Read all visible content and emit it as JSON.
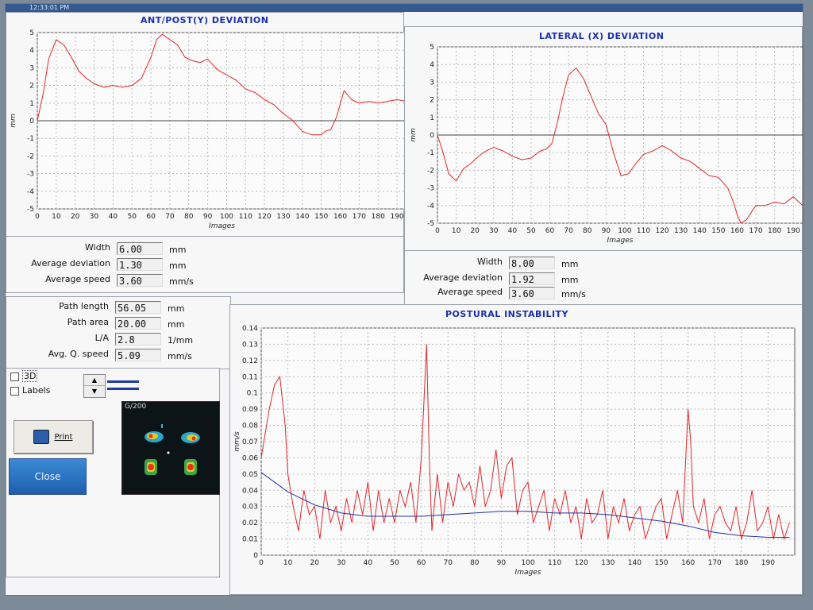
{
  "window": {
    "title": "12:33:01 PM"
  },
  "charts": {
    "ap": {
      "title": "ANT/POST(Y) DEVIATION",
      "ylabel": "mm",
      "xlabel": "Images",
      "yticks": [
        "5",
        "4",
        "3",
        "2",
        "1",
        "0",
        "-1",
        "-2",
        "-3",
        "-4",
        "-5"
      ],
      "xticks": [
        "0",
        "10",
        "20",
        "30",
        "40",
        "50",
        "60",
        "70",
        "80",
        "90",
        "100",
        "110",
        "120",
        "130",
        "140",
        "150",
        "160",
        "170",
        "180",
        "190"
      ]
    },
    "lat": {
      "title": "LATERAL (X) DEVIATION",
      "ylabel": "mm",
      "xlabel": "Images",
      "yticks": [
        "5",
        "4",
        "3",
        "2",
        "1",
        "0",
        "-1",
        "-2",
        "-3",
        "-4",
        "-5"
      ],
      "xticks": [
        "0",
        "10",
        "20",
        "30",
        "40",
        "50",
        "60",
        "70",
        "80",
        "90",
        "100",
        "110",
        "120",
        "130",
        "140",
        "150",
        "160",
        "170",
        "180",
        "190"
      ]
    },
    "pi": {
      "title": "POSTURAL INSTABILITY",
      "ylabel": "mm/s",
      "xlabel": "Images",
      "yticks": [
        "0.14",
        "0.13",
        "0.12",
        "0.11",
        "0.1",
        "0.09",
        "0.08",
        "0.07",
        "0.06",
        "0.05",
        "0.04",
        "0.03",
        "0.02",
        "0.01",
        "0"
      ],
      "xticks": [
        "0",
        "10",
        "20",
        "30",
        "40",
        "50",
        "60",
        "70",
        "80",
        "90",
        "100",
        "110",
        "120",
        "130",
        "140",
        "150",
        "160",
        "170",
        "180",
        "190"
      ]
    }
  },
  "ap_stats": {
    "width_label": "Width",
    "width_value": "6.00",
    "width_unit": "mm",
    "avgdev_label": "Average deviation",
    "avgdev_value": "1.30",
    "avgdev_unit": "mm",
    "avgspeed_label": "Average speed",
    "avgspeed_value": "3.60",
    "avgspeed_unit": "mm/s"
  },
  "lat_stats": {
    "width_label": "Width",
    "width_value": "8.00",
    "width_unit": "mm",
    "avgdev_label": "Average deviation",
    "avgdev_value": "1.92",
    "avgdev_unit": "mm",
    "avgspeed_label": "Average speed",
    "avgspeed_value": "3.60",
    "avgspeed_unit": "mm/s"
  },
  "path_stats": {
    "pathlen_label": "Path length",
    "pathlen_value": "56.05",
    "pathlen_unit": "mm",
    "patharea_label": "Path area",
    "patharea_value": "20.00",
    "patharea_unit": "mm",
    "la_label": "L/A",
    "la_value": "2.8",
    "la_unit": "1/mm",
    "aqs_label": "Avg. Q. speed",
    "aqs_value": "5.09",
    "aqs_unit": "mm/s"
  },
  "controls": {
    "check_3d": "3D",
    "check_labels": "Labels",
    "print_label": "Print",
    "close_label": "Close",
    "thumb_label": "G/200"
  },
  "colors": {
    "series": "#e0282a",
    "trend": "#2233aa",
    "title": "#1a2fb0"
  },
  "chart_data": [
    {
      "type": "line",
      "title": "ANT/POST(Y) DEVIATION",
      "xlabel": "Images",
      "ylabel": "mm",
      "xlim": [
        0,
        195
      ],
      "ylim": [
        -5,
        5
      ],
      "series": [
        {
          "x": [
            0,
            3,
            6,
            10,
            14,
            18,
            22,
            26,
            30,
            35,
            40,
            45,
            50,
            55,
            60,
            63,
            66,
            70,
            74,
            78,
            82,
            86,
            90,
            95,
            100,
            105,
            110,
            115,
            120,
            125,
            130,
            135,
            140,
            145,
            150,
            152,
            155,
            158,
            162,
            166,
            170,
            175,
            180,
            185,
            190,
            195
          ],
          "values": [
            0,
            1.5,
            3.5,
            4.6,
            4.3,
            3.6,
            2.8,
            2.4,
            2.1,
            1.9,
            2.0,
            1.9,
            2.0,
            2.4,
            3.6,
            4.6,
            4.9,
            4.6,
            4.3,
            3.6,
            3.4,
            3.3,
            3.5,
            2.9,
            2.6,
            2.3,
            1.8,
            1.6,
            1.2,
            0.9,
            0.4,
            0.0,
            -0.6,
            -0.8,
            -0.8,
            -0.6,
            -0.5,
            0.2,
            1.7,
            1.2,
            1.0,
            1.1,
            1.0,
            1.1,
            1.2,
            1.1
          ]
        }
      ]
    },
    {
      "type": "line",
      "title": "LATERAL (X) DEVIATION",
      "xlabel": "Images",
      "ylabel": "mm",
      "xlim": [
        0,
        195
      ],
      "ylim": [
        -5,
        5
      ],
      "series": [
        {
          "x": [
            0,
            3,
            6,
            10,
            14,
            18,
            22,
            26,
            30,
            35,
            40,
            45,
            50,
            55,
            58,
            61,
            64,
            67,
            70,
            74,
            78,
            82,
            86,
            90,
            94,
            98,
            102,
            106,
            110,
            115,
            120,
            125,
            130,
            135,
            140,
            145,
            150,
            155,
            158,
            160,
            162,
            165,
            170,
            175,
            180,
            185,
            190,
            195
          ],
          "values": [
            0,
            -1.0,
            -2.2,
            -2.6,
            -1.9,
            -1.6,
            -1.2,
            -0.9,
            -0.7,
            -0.9,
            -1.2,
            -1.4,
            -1.3,
            -0.9,
            -0.8,
            -0.5,
            0.7,
            2.2,
            3.4,
            3.8,
            3.2,
            2.2,
            1.2,
            0.6,
            -1.0,
            -2.3,
            -2.2,
            -1.6,
            -1.1,
            -0.9,
            -0.6,
            -0.9,
            -1.3,
            -1.5,
            -1.9,
            -2.3,
            -2.4,
            -3.0,
            -3.8,
            -4.5,
            -5.0,
            -4.8,
            -4.0,
            -4.0,
            -3.8,
            -3.9,
            -3.5,
            -4.0
          ]
        }
      ]
    },
    {
      "type": "line",
      "title": "POSTURAL INSTABILITY",
      "xlabel": "Images",
      "ylabel": "mm/s",
      "xlim": [
        0,
        200
      ],
      "ylim": [
        0,
        0.14
      ],
      "series": [
        {
          "x": [
            0,
            3,
            5,
            7,
            9,
            10,
            12,
            14,
            16,
            18,
            20,
            22,
            24,
            26,
            28,
            30,
            32,
            34,
            36,
            38,
            40,
            42,
            44,
            46,
            48,
            50,
            52,
            54,
            56,
            58,
            60,
            61,
            62,
            63,
            64,
            66,
            68,
            70,
            72,
            74,
            76,
            78,
            80,
            82,
            84,
            86,
            88,
            90,
            92,
            94,
            96,
            98,
            100,
            102,
            104,
            106,
            108,
            110,
            112,
            114,
            116,
            118,
            120,
            122,
            124,
            126,
            128,
            130,
            132,
            134,
            136,
            138,
            140,
            142,
            144,
            146,
            148,
            150,
            152,
            154,
            156,
            158,
            160,
            161,
            162,
            164,
            166,
            168,
            170,
            172,
            174,
            176,
            178,
            180,
            182,
            184,
            186,
            188,
            190,
            192,
            194,
            196,
            198
          ],
          "values": [
            0.06,
            0.09,
            0.105,
            0.11,
            0.08,
            0.05,
            0.03,
            0.015,
            0.04,
            0.025,
            0.03,
            0.01,
            0.04,
            0.02,
            0.03,
            0.015,
            0.035,
            0.02,
            0.04,
            0.025,
            0.045,
            0.015,
            0.04,
            0.02,
            0.035,
            0.02,
            0.04,
            0.03,
            0.045,
            0.02,
            0.06,
            0.095,
            0.13,
            0.06,
            0.015,
            0.05,
            0.02,
            0.045,
            0.03,
            0.05,
            0.04,
            0.045,
            0.03,
            0.055,
            0.03,
            0.04,
            0.065,
            0.035,
            0.055,
            0.06,
            0.025,
            0.04,
            0.045,
            0.02,
            0.03,
            0.04,
            0.015,
            0.035,
            0.025,
            0.04,
            0.02,
            0.03,
            0.01,
            0.035,
            0.02,
            0.025,
            0.04,
            0.01,
            0.03,
            0.02,
            0.035,
            0.015,
            0.025,
            0.03,
            0.01,
            0.02,
            0.03,
            0.035,
            0.01,
            0.025,
            0.04,
            0.02,
            0.09,
            0.07,
            0.03,
            0.02,
            0.035,
            0.01,
            0.025,
            0.03,
            0.02,
            0.015,
            0.03,
            0.01,
            0.02,
            0.04,
            0.015,
            0.02,
            0.03,
            0.01,
            0.025,
            0.01,
            0.02
          ]
        },
        {
          "x": [
            0,
            10,
            20,
            30,
            40,
            50,
            60,
            70,
            80,
            90,
            100,
            110,
            120,
            130,
            140,
            150,
            160,
            170,
            180,
            190,
            198
          ],
          "values": [
            0.051,
            0.039,
            0.031,
            0.026,
            0.024,
            0.024,
            0.024,
            0.025,
            0.026,
            0.027,
            0.027,
            0.026,
            0.026,
            0.025,
            0.023,
            0.021,
            0.018,
            0.014,
            0.012,
            0.011,
            0.011
          ]
        }
      ]
    }
  ]
}
